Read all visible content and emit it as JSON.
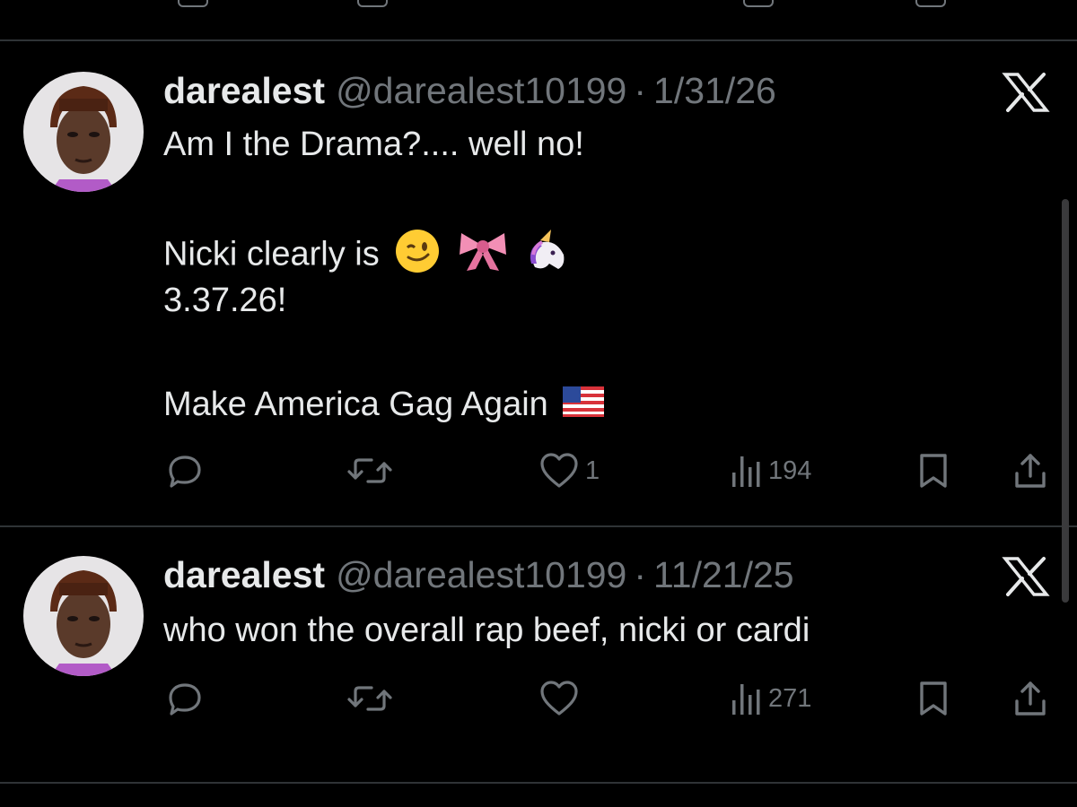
{
  "tweets": [
    {
      "display_name": "darealest",
      "handle": "@darealest10199",
      "separator": "·",
      "date": "1/31/26",
      "lines": [
        "Am I the Drama?.... well no!",
        "Nicki clearly is",
        "3.37.26!",
        "Make America Gag Again"
      ],
      "emojis_line2": [
        "winking-face",
        "pink-bow",
        "unicorn"
      ],
      "emojis_line4": [
        "us-flag"
      ],
      "like_count": "1",
      "view_count": "194"
    },
    {
      "display_name": "darealest",
      "handle": "@darealest10199",
      "separator": "·",
      "date": "11/21/25",
      "lines": [
        "who won the overall rap beef, nicki or cardi"
      ],
      "view_count": "271"
    }
  ],
  "icons": {
    "reply": "reply-icon",
    "repost": "repost-icon",
    "like": "heart-icon",
    "views": "views-icon",
    "bookmark": "bookmark-icon",
    "share": "share-icon",
    "platform": "x-logo-icon"
  },
  "colors": {
    "background": "#000000",
    "primary_text": "#e7e9ea",
    "secondary_text": "#71767b",
    "divider": "#2f3336"
  }
}
